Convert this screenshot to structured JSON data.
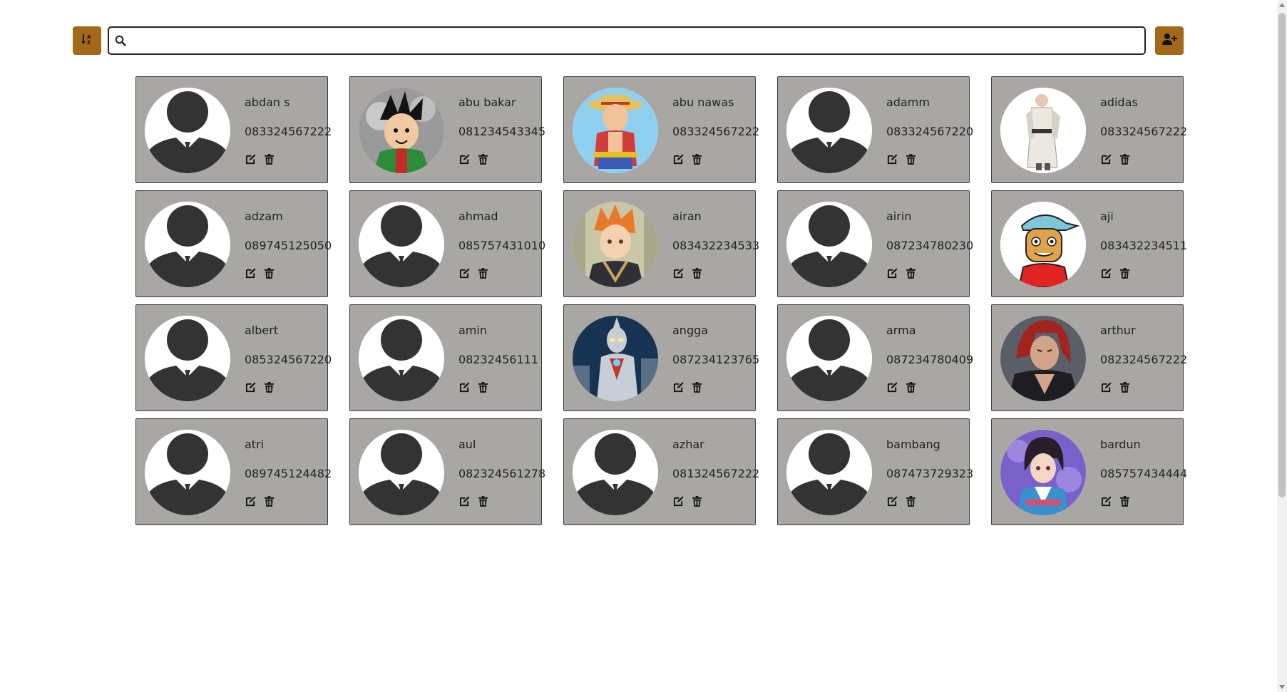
{
  "toolbar": {
    "sort_icon": "sort-alpha-down-icon",
    "add_icon": "user-plus-icon",
    "accent_color": "#a26a16"
  },
  "search": {
    "placeholder": "",
    "value": ""
  },
  "card_color": "#a9a7a3",
  "contacts": [
    {
      "name": "abdan s",
      "phone": "083324567222",
      "avatar": "default-silhouette"
    },
    {
      "name": "abu bakar",
      "phone": "081234543345",
      "avatar": "anime-boy-green"
    },
    {
      "name": "abu nawas",
      "phone": "083324567222",
      "avatar": "straw-hat-pirate"
    },
    {
      "name": "adamm",
      "phone": "083324567220",
      "avatar": "default-silhouette"
    },
    {
      "name": "adidas",
      "phone": "083324567222",
      "avatar": "white-robed-figure"
    },
    {
      "name": "adzam",
      "phone": "089745125050",
      "avatar": "default-silhouette"
    },
    {
      "name": "ahmad",
      "phone": "085757431010",
      "avatar": "default-silhouette"
    },
    {
      "name": "airan",
      "phone": "083432234533",
      "avatar": "orange-hair-anime"
    },
    {
      "name": "airin",
      "phone": "087234780230",
      "avatar": "default-silhouette"
    },
    {
      "name": "aji",
      "phone": "083432234511",
      "avatar": "cartoon-cap-kid"
    },
    {
      "name": "albert",
      "phone": "085324567220",
      "avatar": "default-silhouette"
    },
    {
      "name": "amin",
      "phone": "08232456111",
      "avatar": "default-silhouette"
    },
    {
      "name": "angga",
      "phone": "087234123765",
      "avatar": "silver-hero"
    },
    {
      "name": "arma",
      "phone": "087234780409",
      "avatar": "default-silhouette"
    },
    {
      "name": "arthur",
      "phone": "082324567222",
      "avatar": "red-hair-anime"
    },
    {
      "name": "atri",
      "phone": "089745124482",
      "avatar": "default-silhouette"
    },
    {
      "name": "aul",
      "phone": "082324561278",
      "avatar": "default-silhouette"
    },
    {
      "name": "azhar",
      "phone": "081324567222",
      "avatar": "default-silhouette"
    },
    {
      "name": "bambang",
      "phone": "087473729323",
      "avatar": "default-silhouette"
    },
    {
      "name": "bardun",
      "phone": "085757434444",
      "avatar": "purple-anime"
    }
  ]
}
